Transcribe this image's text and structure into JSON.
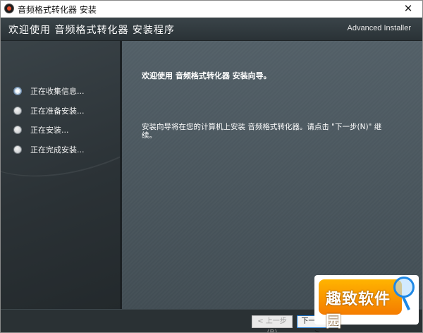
{
  "window": {
    "title": "音频格式转化器 安装",
    "close_glyph": "✕"
  },
  "header": {
    "title": "欢迎使用 音频格式转化器 安装程序",
    "brand": "Advanced Installer"
  },
  "steps": [
    {
      "label": "正在收集信息...",
      "active": true
    },
    {
      "label": "正在准备安装...",
      "active": false
    },
    {
      "label": "正在安装...",
      "active": false
    },
    {
      "label": "正在完成安装...",
      "active": false
    }
  ],
  "main": {
    "heading": "欢迎使用 音频格式转化器 安装向导。",
    "description": "安装向导将在您的计算机上安装 音频格式转化器。请点击 \"下一步(N)\" 继续。"
  },
  "footer": {
    "back_label": "< 上一步(B)",
    "next_label": "下一步(N) >"
  },
  "watermark": {
    "text": "趣致软件园"
  },
  "icons": {
    "app": "audio-disc-icon",
    "close": "close-icon",
    "radio": "radio-button-icon",
    "watermark": "magnifier-icon"
  }
}
